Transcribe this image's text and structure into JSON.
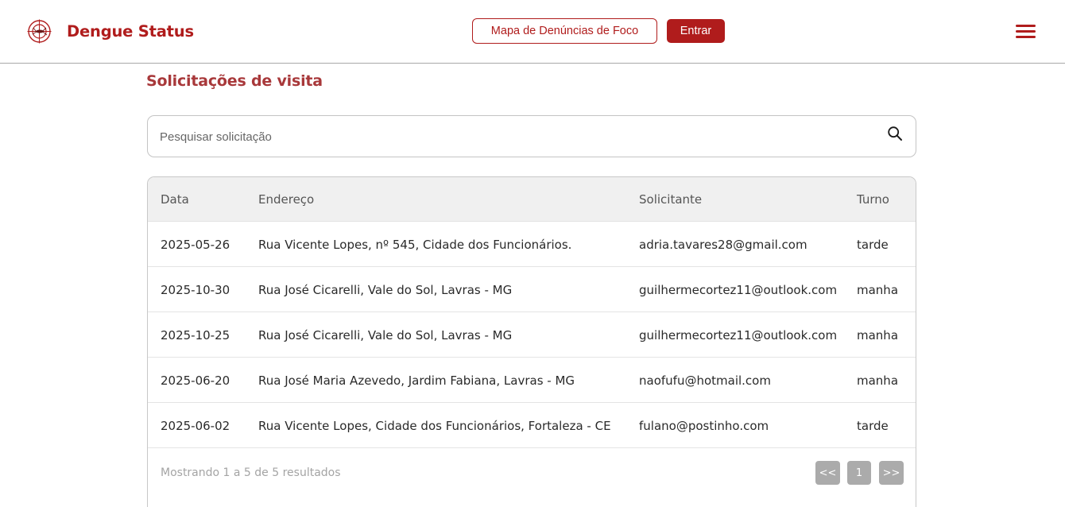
{
  "header": {
    "brand": "Dengue Status",
    "map_button": "Mapa de Denúncias de Foco",
    "login_button": "Entrar",
    "brand_color": "#b01c1c"
  },
  "page": {
    "title": "Solicitações de visita"
  },
  "search": {
    "placeholder": "Pesquisar solicitação",
    "value": ""
  },
  "table": {
    "columns": [
      "Data",
      "Endereço",
      "Solicitante",
      "Turno"
    ],
    "rows": [
      [
        "2025-05-26",
        "Rua Vicente Lopes, nº 545, Cidade dos Funcionários.",
        "adria.tavares28@gmail.com",
        "tarde"
      ],
      [
        "2025-10-30",
        "Rua José Cicarelli, Vale do Sol, Lavras - MG",
        "guilhermecortez11@outlook.com",
        "manha"
      ],
      [
        "2025-10-25",
        "Rua José Cicarelli, Vale do Sol, Lavras - MG",
        "guilhermecortez11@outlook.com",
        "manha"
      ],
      [
        "2025-06-20",
        "Rua José Maria Azevedo, Jardim Fabiana, Lavras - MG",
        "naofufu@hotmail.com",
        "manha"
      ],
      [
        "2025-06-02",
        "Rua Vicente Lopes, Cidade dos Funcionários, Fortaleza - CE",
        "fulano@postinho.com",
        "tarde"
      ]
    ]
  },
  "pagination": {
    "summary": "Mostrando 1 a 5 de 5 resultados",
    "prev": "<<",
    "current": "1",
    "next": ">>"
  },
  "icons": {
    "logo": "mosquito-target-icon",
    "search": "search-icon",
    "menu": "hamburger-menu-icon"
  }
}
